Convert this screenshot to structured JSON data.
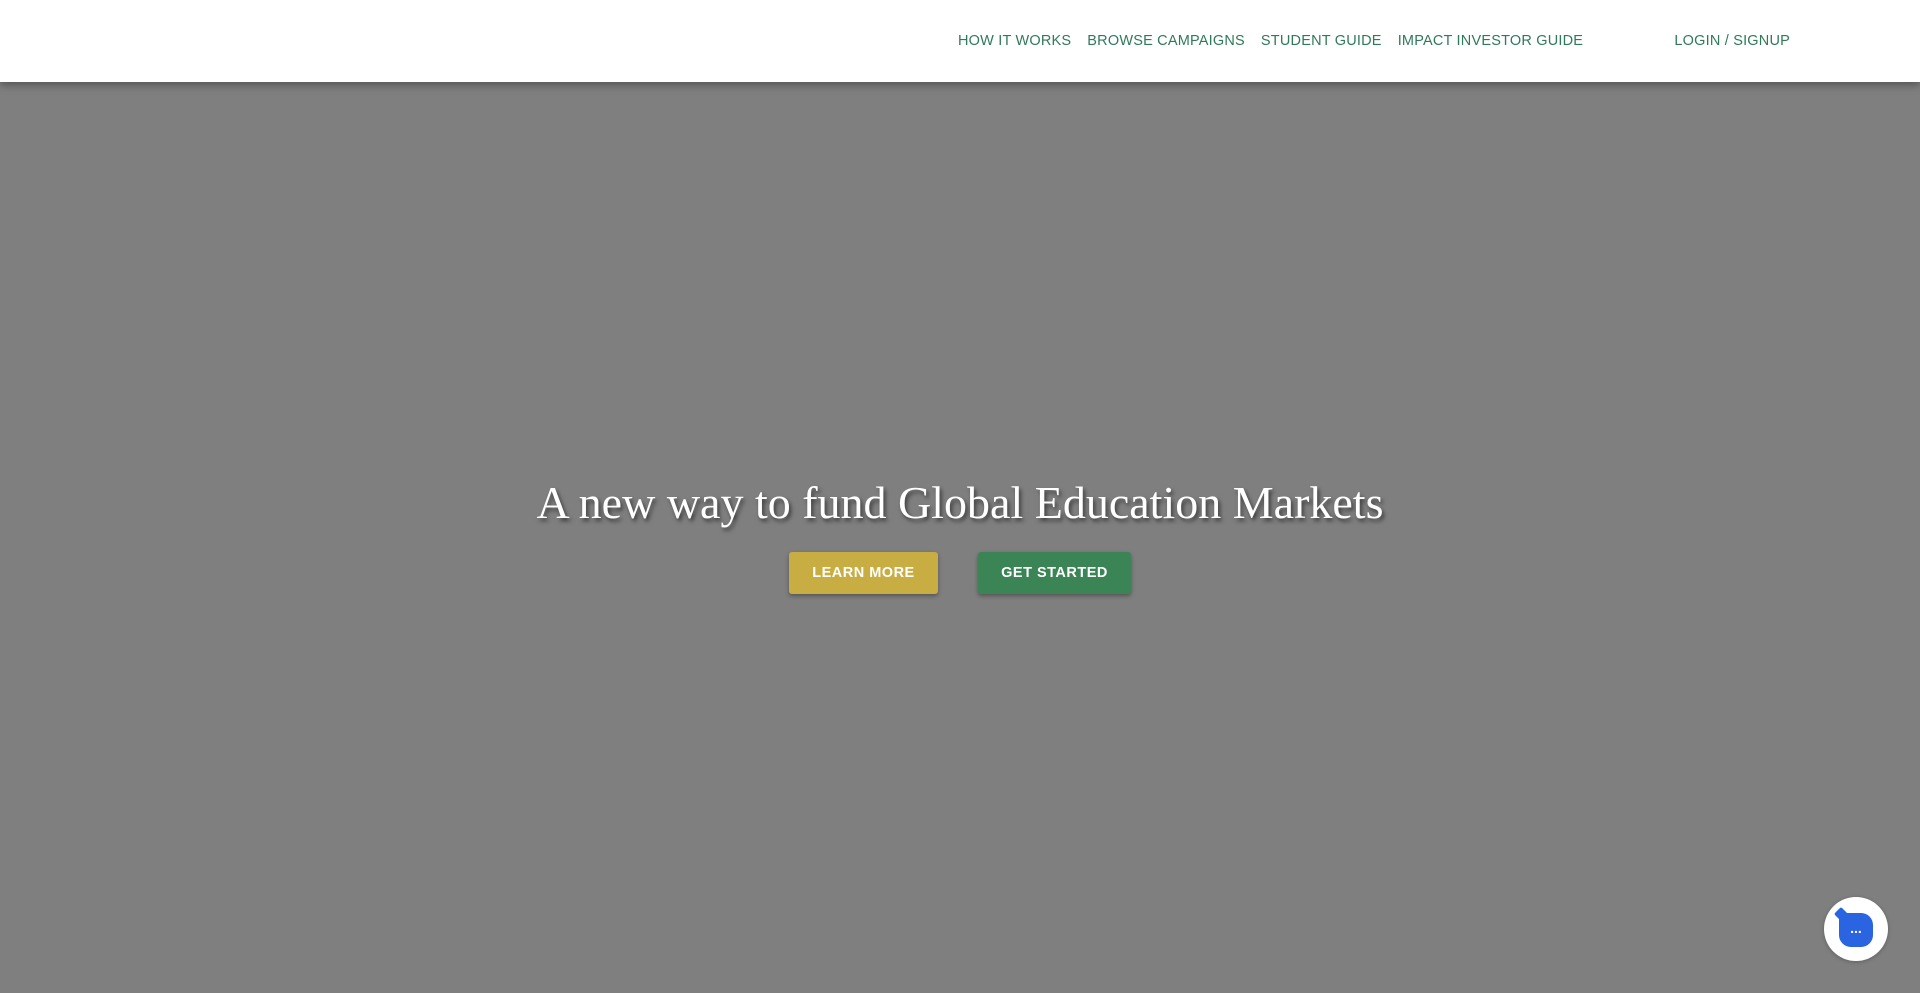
{
  "nav": {
    "links": [
      {
        "label": "HOW IT WORKS"
      },
      {
        "label": "BROWSE CAMPAIGNS"
      },
      {
        "label": "STUDENT GUIDE"
      },
      {
        "label": "IMPACT INVESTOR GUIDE"
      }
    ],
    "login_label": "LOGIN / SIGNUP",
    "link_color": "#2f7a5a"
  },
  "hero": {
    "title": "A new way to fund Global Education Markets",
    "learn_more_label": "LEARN MORE",
    "get_started_label": "GET STARTED",
    "background_color": "#7f7f7f",
    "learn_more_color": "#c8ad43",
    "get_started_color": "#3a8455"
  },
  "chat": {
    "icon": "chat-bubble-icon",
    "dots": "...",
    "color": "#2b64e0"
  }
}
